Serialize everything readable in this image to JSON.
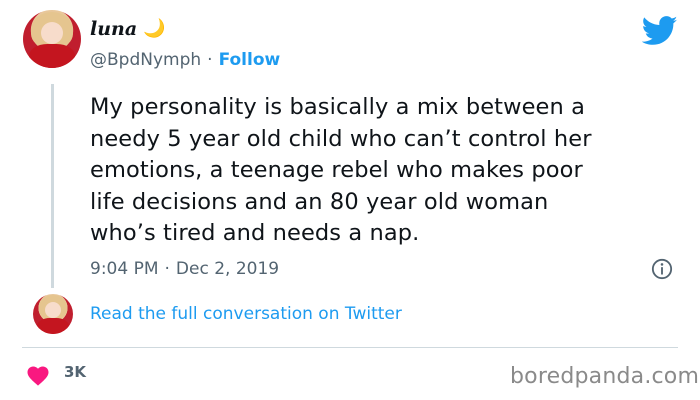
{
  "tweet": {
    "author": {
      "display_name": "luna",
      "emoji": "🌙",
      "handle": "@BpdNymph",
      "separator": "·",
      "follow_label": "Follow"
    },
    "text": "My personality is basically a mix between a\nneedy 5 year old child who can’t control her\nemotions, a teenage rebel who makes poor\nlife decisions and an 80 year old woman\nwho’s tired and needs a nap.",
    "time": "9:04 PM",
    "separator": "·",
    "date": "Dec 2, 2019",
    "read_more_label": "Read the full conversation on Twitter",
    "likes": "3K"
  },
  "watermark": "boredpanda.com",
  "colors": {
    "accent": "#1d9bf0",
    "heart": "#f91880",
    "text": "#0f1419",
    "muted": "#536471"
  },
  "icons": [
    "twitter-bird-icon",
    "info-icon",
    "heart-icon",
    "moon-icon"
  ]
}
